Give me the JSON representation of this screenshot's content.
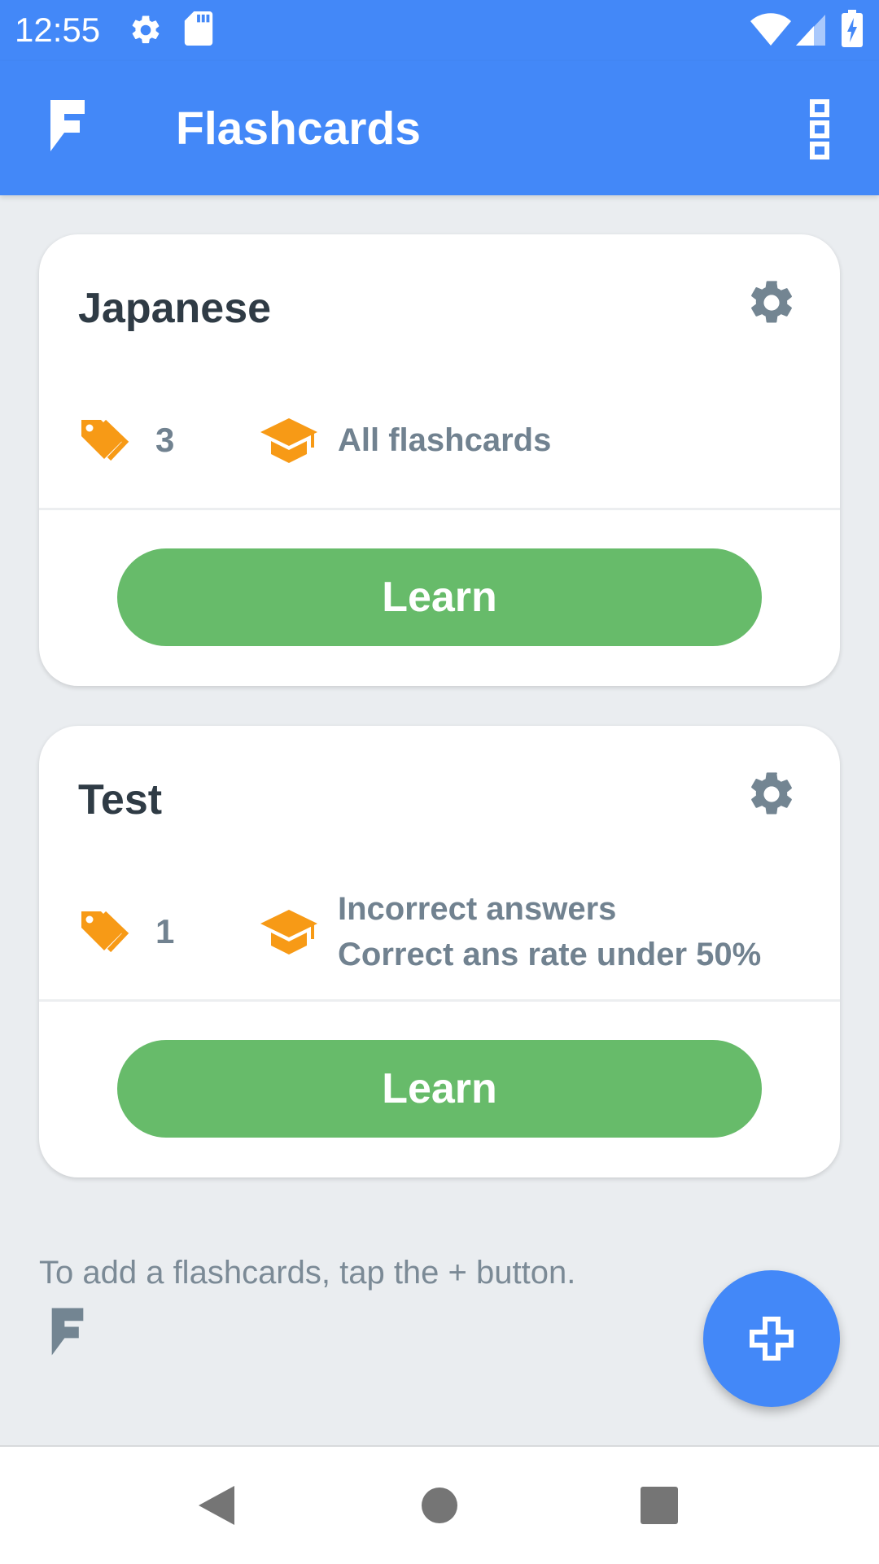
{
  "status_bar": {
    "time": "12:55",
    "icons": [
      "settings-icon",
      "sd-card-icon",
      "wifi-icon",
      "signal-icon",
      "battery-charging-icon"
    ]
  },
  "app_bar": {
    "logo_icon": "flashcards-logo-icon",
    "title": "Flashcards",
    "menu_icon": "more-vertical-icon"
  },
  "decks": [
    {
      "title": "Japanese",
      "settings_icon": "gear-icon",
      "tag_count": "3",
      "mode_lines": [
        "All flashcards"
      ],
      "learn_label": "Learn"
    },
    {
      "title": "Test",
      "settings_icon": "gear-icon",
      "tag_count": "1",
      "mode_lines": [
        "Incorrect answers",
        "Correct ans rate under 50%"
      ],
      "learn_label": "Learn"
    }
  ],
  "hint": {
    "text": "To add a flashcards, tap the + button."
  },
  "fab": {
    "icon": "add-icon"
  },
  "nav_bar": {
    "buttons": [
      "back-icon",
      "home-icon",
      "recents-icon"
    ]
  },
  "colors": {
    "primary": "#4388f8",
    "learn_button": "#67bb6a",
    "accent_icon": "#f79a16",
    "background": "#eaedf0",
    "secondary_text": "#718290"
  }
}
